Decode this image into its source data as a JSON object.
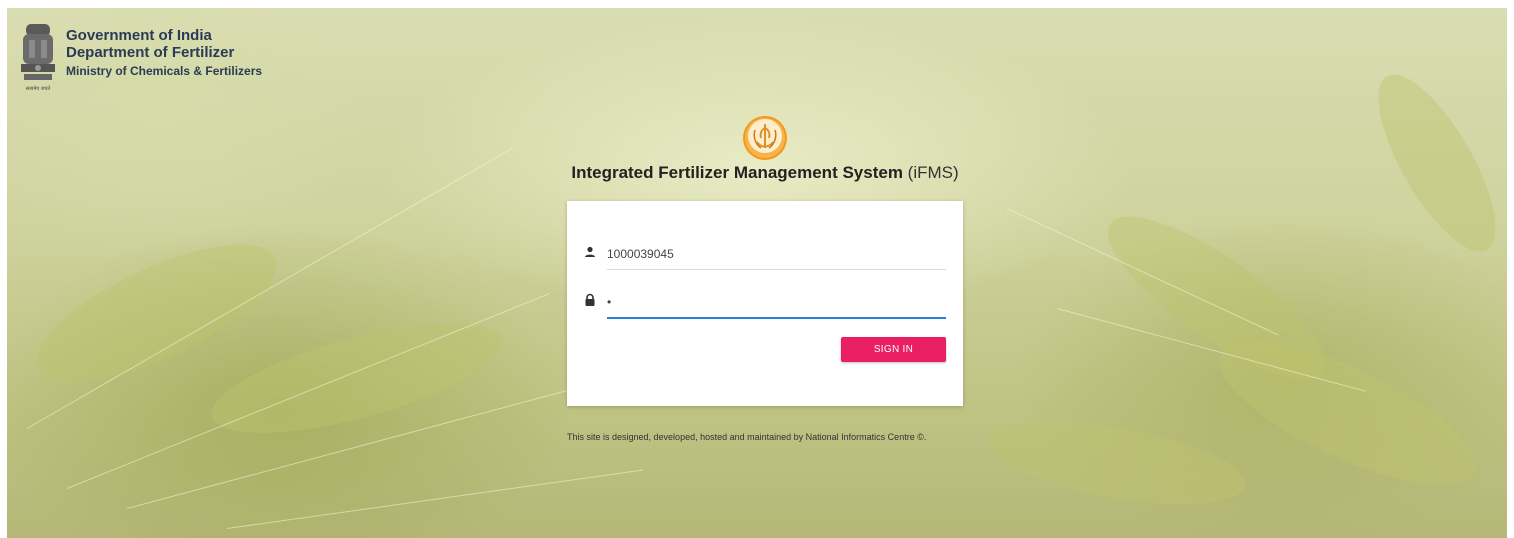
{
  "header": {
    "line1": "Government of India",
    "line2": "Department of Fertilizer",
    "line3": "Ministry of Chemicals & Fertilizers",
    "emblem_icon": "national-emblem-icon",
    "emblem_motto": "सत्यमेव जयते"
  },
  "app": {
    "logo_icon": "wheat-logo-icon",
    "title_main": "Integrated Fertilizer Management System",
    "title_abbr": "(iFMS)"
  },
  "login": {
    "username_value": "1000039045",
    "username_icon": "user-icon",
    "password_value": "•",
    "password_icon": "lock-icon",
    "signin_label": "SIGN IN"
  },
  "footer": {
    "text": "This site is designed, developed, hosted and maintained by National Informatics Centre ©."
  },
  "colors": {
    "accent": "#e91e63",
    "focus_underline": "#2a7fd4",
    "title_text": "#2b3a55"
  }
}
